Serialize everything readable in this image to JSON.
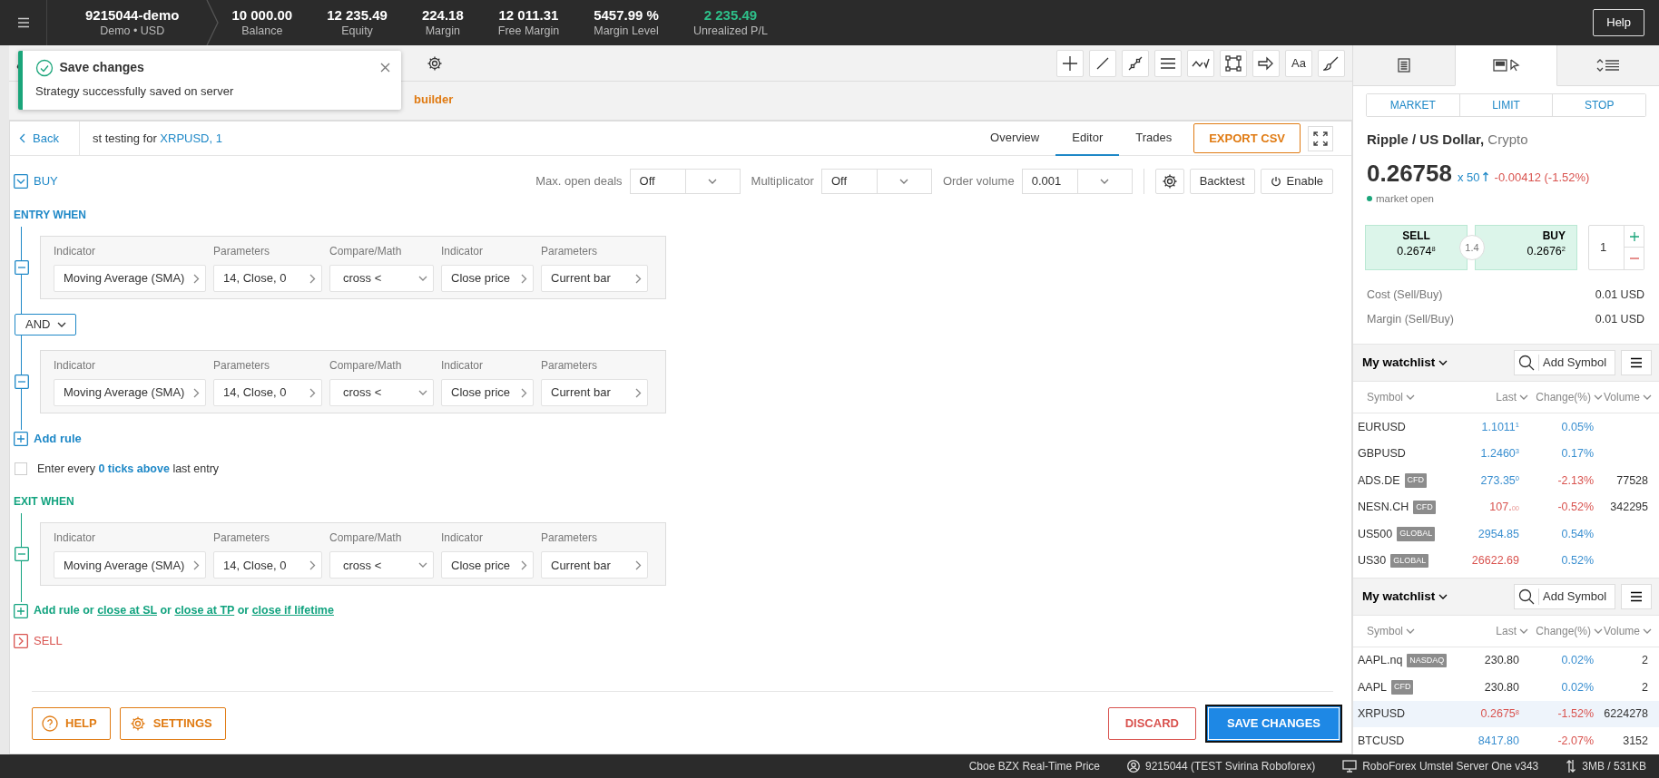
{
  "top_bar": {
    "account": "9215044-demo",
    "account_sub": "Demo • USD",
    "stats": [
      {
        "value": "10 000.00",
        "label": "Balance",
        "profit": false
      },
      {
        "value": "12 235.49",
        "label": "Equity",
        "profit": false
      },
      {
        "value": "224.18",
        "label": "Margin",
        "profit": false
      },
      {
        "value": "12 011.31",
        "label": "Free Margin",
        "profit": false
      },
      {
        "value": "5457.99 %",
        "label": "Margin Level",
        "profit": false
      },
      {
        "value": "2 235.49",
        "label": "Unrealized P/L",
        "profit": true
      }
    ],
    "help": "Help"
  },
  "toast": {
    "title": "Save changes",
    "message": "Strategy successfully saved on server"
  },
  "toolbar": {
    "tools": [
      {
        "kind": "crosshair"
      },
      {
        "kind": "line"
      },
      {
        "kind": "segment"
      },
      {
        "kind": "lines"
      },
      {
        "kind": "wave"
      },
      {
        "kind": "rectangle"
      },
      {
        "kind": "arrow"
      },
      {
        "kind": "text",
        "label": "Aa"
      },
      {
        "kind": "brush"
      }
    ]
  },
  "panel_heading_fragment": "builder",
  "strategy": {
    "back": "Back",
    "title": "st testing for ",
    "symbol": "XRPUSD, 1",
    "tabs": [
      {
        "label": "Overview",
        "selected": false
      },
      {
        "label": "Editor",
        "selected": true
      },
      {
        "label": "Trades",
        "selected": false
      }
    ],
    "export": "EXPORT CSV"
  },
  "buy": {
    "label": "BUY",
    "expanded": true
  },
  "settings": [
    {
      "label": "Max. open deals",
      "value": "Off"
    },
    {
      "label": "Multiplicator",
      "value": "Off"
    },
    {
      "label": "Order volume",
      "value": "0.001"
    }
  ],
  "backtest": "Backtest",
  "enable": "Enable",
  "entry": {
    "title": "ENTRY WHEN",
    "joiner": "AND",
    "add_rule": "Add rule",
    "rules": [
      {
        "fields": [
          {
            "label": "Indicator",
            "value": "Moving Average (SMA)",
            "kind": "drill"
          },
          {
            "label": "Parameters",
            "value": "14, Close, 0",
            "kind": "drill"
          },
          {
            "label": "Compare/Math",
            "value": "cross <",
            "kind": "dropdown"
          },
          {
            "label": "Indicator",
            "value": "Close price",
            "kind": "drill"
          },
          {
            "label": "Parameters",
            "value": "Current bar",
            "kind": "drill"
          }
        ]
      },
      {
        "fields": [
          {
            "label": "Indicator",
            "value": "Moving Average (SMA)",
            "kind": "drill"
          },
          {
            "label": "Parameters",
            "value": "14, Close, 0",
            "kind": "drill"
          },
          {
            "label": "Compare/Math",
            "value": "cross <",
            "kind": "dropdown"
          },
          {
            "label": "Indicator",
            "value": "Close price",
            "kind": "drill"
          },
          {
            "label": "Parameters",
            "value": "Current bar",
            "kind": "drill"
          }
        ]
      }
    ]
  },
  "enter_every": {
    "checked": false,
    "parts": [
      {
        "text": "Enter every ",
        "kind": "plain"
      },
      {
        "text": "0 ticks above",
        "kind": "link"
      },
      {
        "text": " last entry",
        "kind": "plain"
      }
    ]
  },
  "exit": {
    "title": "EXIT WHEN",
    "rules": [
      {
        "fields": [
          {
            "label": "Indicator",
            "value": "Moving Average (SMA)",
            "kind": "drill"
          },
          {
            "label": "Parameters",
            "value": "14, Close, 0",
            "kind": "drill"
          },
          {
            "label": "Compare/Math",
            "value": "cross <",
            "kind": "dropdown"
          },
          {
            "label": "Indicator",
            "value": "Close price",
            "kind": "drill"
          },
          {
            "label": "Parameters",
            "value": "Current bar",
            "kind": "drill"
          }
        ]
      }
    ],
    "add_parts": [
      {
        "text": "Add rule",
        "kind": "action"
      },
      {
        "text": " or ",
        "kind": "plain"
      },
      {
        "text": "close at SL",
        "kind": "link"
      },
      {
        "text": " or ",
        "kind": "plain"
      },
      {
        "text": "close at TP",
        "kind": "link"
      },
      {
        "text": " or ",
        "kind": "plain"
      },
      {
        "text": "close if lifetime",
        "kind": "link"
      }
    ]
  },
  "sell": {
    "label": "SELL",
    "expanded": false
  },
  "footer": {
    "help": "HELP",
    "settings": "SETTINGS",
    "discard": "DISCARD",
    "save": "SAVE CHANGES"
  },
  "side_tabs": [
    {
      "kind": "document",
      "selected": false
    },
    {
      "kind": "order",
      "selected": true
    },
    {
      "kind": "sort",
      "selected": false
    }
  ],
  "order_types": [
    "MARKET",
    "LIMIT",
    "STOP"
  ],
  "instrument": {
    "name": "Ripple / US Dollar,",
    "category": "Crypto",
    "price": "0.26758",
    "leverage": "x 50",
    "change": "-0.00412 (-1.52%)",
    "status": "market open",
    "sell_label": "SELL",
    "sell_price": "0.2674$^{8}$",
    "spread": "1.4",
    "buy_label": "BUY",
    "buy_price": "0.2676$^{2}$",
    "quantity": "1"
  },
  "costs": [
    {
      "label": "Cost (Sell/Buy)",
      "value": "0.01 USD"
    },
    {
      "label": "Margin (Sell/Buy)",
      "value": "0.01 USD"
    }
  ],
  "watchlists": [
    {
      "title": "My watchlist",
      "placeholder": "Add Symbol",
      "columns": [
        "Symbol",
        "Last",
        "Change(%)",
        "Volume"
      ],
      "rows": [
        {
          "symbol": "EURUSD",
          "last": {
            "text": "1.1011$^{1}$",
            "color": "#3a8fd0"
          },
          "change": "0.05%",
          "change_negative": false,
          "selected": false
        },
        {
          "symbol": "GBPUSD",
          "last": {
            "text": "1.2460$^{3}$",
            "color": "#3a8fd0"
          },
          "change": "0.17%",
          "change_negative": false,
          "selected": false
        },
        {
          "symbol": "ADS.DE",
          "tag": "CFD",
          "last": {
            "text": "273.35$^{0}$",
            "color": "#3a8fd0"
          },
          "change": "-2.13%",
          "change_negative": true,
          "volume": "77528",
          "selected": false
        },
        {
          "symbol": "NESN.CH",
          "tag": "CFD",
          "last": {
            "text": "107.$_{00}$",
            "color": "#d9534f"
          },
          "change": "-0.52%",
          "change_negative": true,
          "volume": "342295",
          "selected": false
        },
        {
          "symbol": "US500",
          "tag": "GLOBAL",
          "last": {
            "text": "2954.85",
            "color": "#3a8fd0"
          },
          "change": "0.54%",
          "change_negative": false,
          "selected": false
        },
        {
          "symbol": "US30",
          "tag": "GLOBAL",
          "last": {
            "text": "26622.69",
            "color": "#d9534f"
          },
          "change": "0.52%",
          "change_negative": false,
          "selected": false
        }
      ]
    },
    {
      "title": "My watchlist",
      "placeholder": "Add Symbol",
      "columns": [
        "Symbol",
        "Last",
        "Change(%)",
        "Volume"
      ],
      "rows": [
        {
          "symbol": "AAPL.nq",
          "tag": "NASDAQ",
          "last": {
            "text": "230.80",
            "color": "#333333"
          },
          "change": "0.02%",
          "change_negative": false,
          "volume": "2",
          "selected": false
        },
        {
          "symbol": "AAPL",
          "tag": "CFD",
          "last": {
            "text": "230.80",
            "color": "#333333"
          },
          "change": "0.02%",
          "change_negative": false,
          "volume": "2",
          "selected": false
        },
        {
          "symbol": "XRPUSD",
          "last": {
            "text": "0.2675$^{8}$",
            "color": "#d9534f"
          },
          "change": "-1.52%",
          "change_negative": true,
          "volume": "6224278",
          "selected": true
        },
        {
          "symbol": "BTCUSD",
          "last": {
            "text": "8417.80",
            "color": "#3a8fd0"
          },
          "change": "-2.07%",
          "change_negative": true,
          "volume": "3152",
          "selected": false
        }
      ]
    }
  ],
  "status_bar": [
    {
      "kind": "feed",
      "text": "Cboe BZX Real-Time Price"
    },
    {
      "kind": "user",
      "text": "9215044 (TEST Svirina Roboforex)"
    },
    {
      "kind": "server",
      "text": "RoboForex Umstel Server One v343"
    },
    {
      "kind": "traffic",
      "text": "3MB / 531KB"
    }
  ]
}
